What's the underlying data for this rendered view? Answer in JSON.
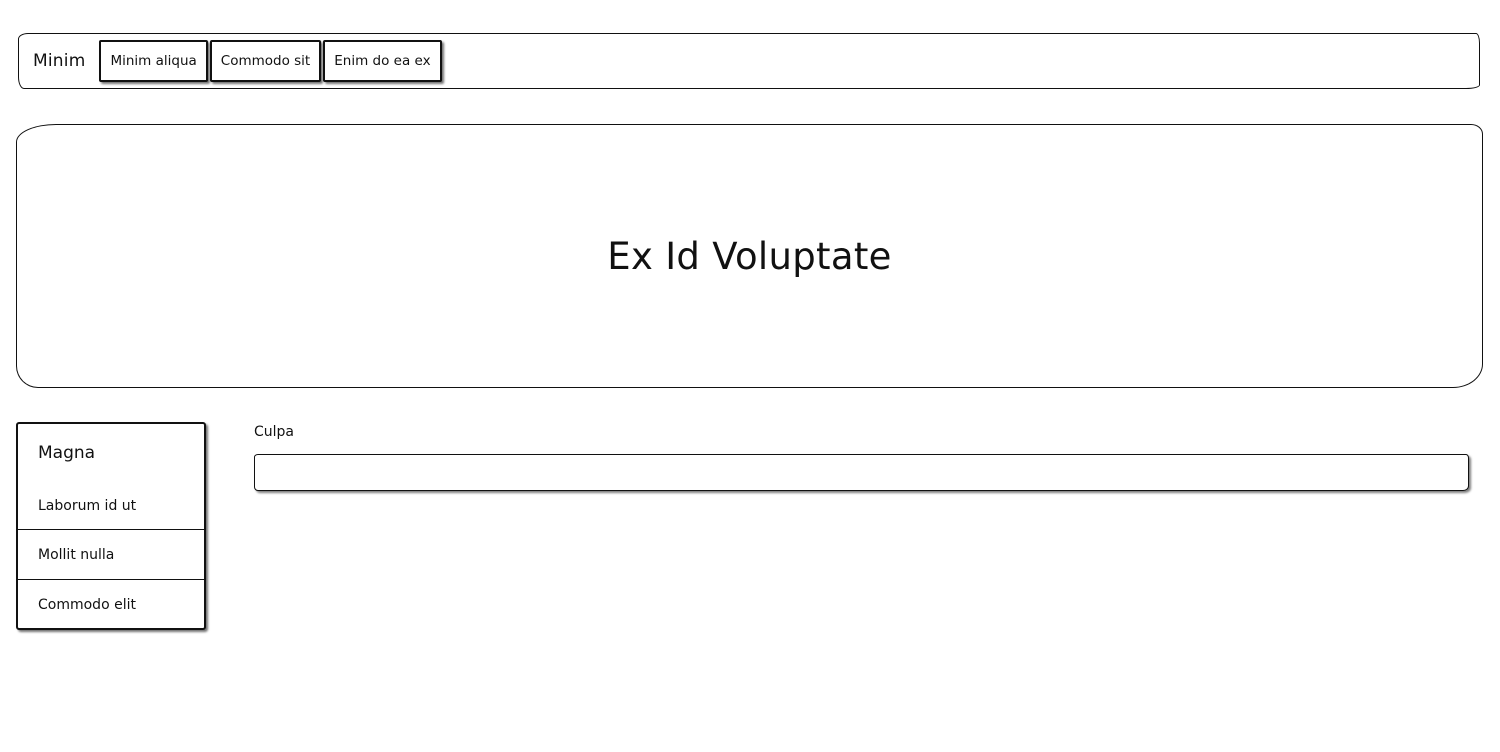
{
  "navbar": {
    "brand": "Minim",
    "items": [
      {
        "label": "Minim aliqua"
      },
      {
        "label": "Commodo sit"
      },
      {
        "label": "Enim do ea ex"
      }
    ]
  },
  "hero": {
    "title": "Ex Id Voluptate"
  },
  "sidebar": {
    "header": "Magna",
    "items": [
      {
        "label": "Laborum id ut"
      },
      {
        "label": "Mollit nulla"
      },
      {
        "label": "Commodo elit"
      }
    ]
  },
  "form": {
    "field_label": "Culpa",
    "field_value": "",
    "field_placeholder": ""
  }
}
